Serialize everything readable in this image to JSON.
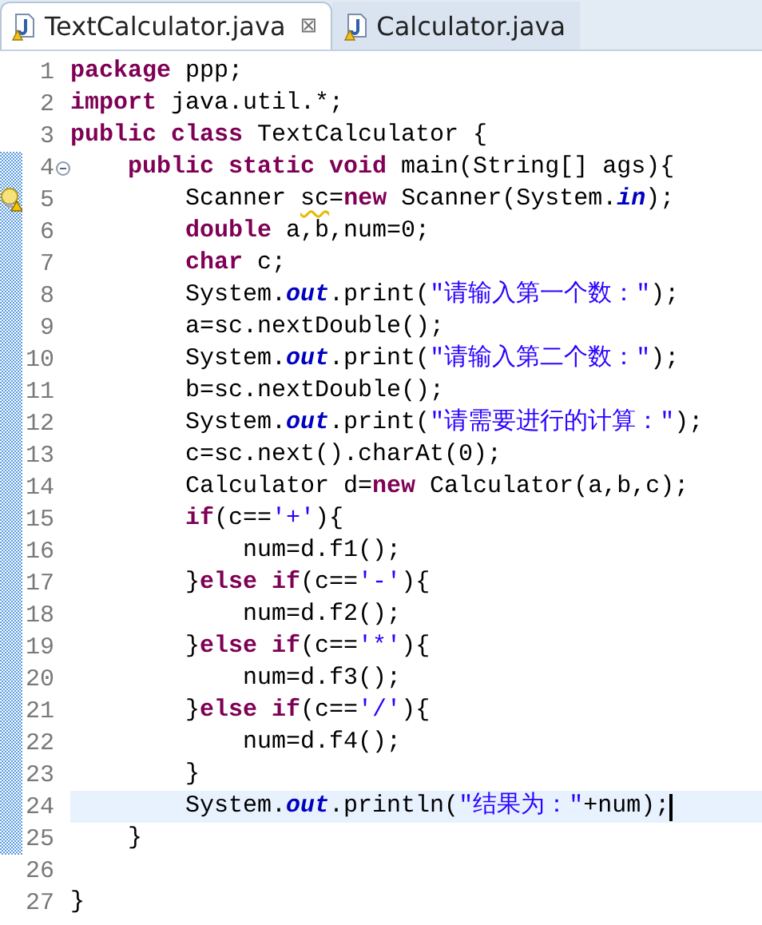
{
  "tabs": [
    {
      "label": "TextCalculator.java",
      "selected": true,
      "close": "⊠"
    },
    {
      "label": "Calculator.java",
      "selected": false
    }
  ],
  "lines": [
    {
      "number": "1",
      "changed": false,
      "current": false,
      "collapsible": false,
      "warning": false,
      "tokens": [
        {
          "kind": "kw",
          "text": "package"
        },
        {
          "kind": "text",
          "text": " ppp;"
        }
      ]
    },
    {
      "number": "2",
      "changed": false,
      "current": false,
      "collapsible": false,
      "warning": false,
      "tokens": [
        {
          "kind": "kw",
          "text": "import"
        },
        {
          "kind": "text",
          "text": " java.util.*;"
        }
      ]
    },
    {
      "number": "3",
      "changed": false,
      "current": false,
      "collapsible": false,
      "warning": false,
      "tokens": [
        {
          "kind": "kw",
          "text": "public class"
        },
        {
          "kind": "text",
          "text": " TextCalculator {"
        }
      ]
    },
    {
      "number": "4",
      "changed": true,
      "current": false,
      "collapsible": true,
      "warning": false,
      "tokens": [
        {
          "kind": "kw",
          "text": "    public static void"
        },
        {
          "kind": "text",
          "text": " main(String[] ags){"
        }
      ]
    },
    {
      "number": "5",
      "changed": true,
      "current": false,
      "collapsible": false,
      "warning": true,
      "tokens": [
        {
          "kind": "text",
          "text": "        Scanner "
        },
        {
          "kind": "warn",
          "text": "sc"
        },
        {
          "kind": "text",
          "text": "="
        },
        {
          "kind": "kw",
          "text": "new"
        },
        {
          "kind": "text",
          "text": " Scanner(System."
        },
        {
          "kind": "field",
          "text": "in"
        },
        {
          "kind": "text",
          "text": ");"
        }
      ]
    },
    {
      "number": "6",
      "changed": true,
      "current": false,
      "collapsible": false,
      "warning": false,
      "tokens": [
        {
          "kind": "kw",
          "text": "        double"
        },
        {
          "kind": "text",
          "text": " a,b,num=0;"
        }
      ]
    },
    {
      "number": "7",
      "changed": true,
      "current": false,
      "collapsible": false,
      "warning": false,
      "tokens": [
        {
          "kind": "kw",
          "text": "        char"
        },
        {
          "kind": "text",
          "text": " c;"
        }
      ]
    },
    {
      "number": "8",
      "changed": true,
      "current": false,
      "collapsible": false,
      "warning": false,
      "tokens": [
        {
          "kind": "text",
          "text": "        System."
        },
        {
          "kind": "field",
          "text": "out"
        },
        {
          "kind": "text",
          "text": ".print("
        },
        {
          "kind": "str",
          "text": "\"请输入第一个数：\""
        },
        {
          "kind": "text",
          "text": ");"
        }
      ]
    },
    {
      "number": "9",
      "changed": true,
      "current": false,
      "collapsible": false,
      "warning": false,
      "tokens": [
        {
          "kind": "text",
          "text": "        a=sc.nextDouble();"
        }
      ]
    },
    {
      "number": "10",
      "changed": true,
      "current": false,
      "collapsible": false,
      "warning": false,
      "tokens": [
        {
          "kind": "text",
          "text": "        System."
        },
        {
          "kind": "field",
          "text": "out"
        },
        {
          "kind": "text",
          "text": ".print("
        },
        {
          "kind": "str",
          "text": "\"请输入第二个数：\""
        },
        {
          "kind": "text",
          "text": ");"
        }
      ]
    },
    {
      "number": "11",
      "changed": true,
      "current": false,
      "collapsible": false,
      "warning": false,
      "tokens": [
        {
          "kind": "text",
          "text": "        b=sc.nextDouble();"
        }
      ]
    },
    {
      "number": "12",
      "changed": true,
      "current": false,
      "collapsible": false,
      "warning": false,
      "tokens": [
        {
          "kind": "text",
          "text": "        System."
        },
        {
          "kind": "field",
          "text": "out"
        },
        {
          "kind": "text",
          "text": ".print("
        },
        {
          "kind": "str",
          "text": "\"请需要进行的计算：\""
        },
        {
          "kind": "text",
          "text": ");"
        }
      ]
    },
    {
      "number": "13",
      "changed": true,
      "current": false,
      "collapsible": false,
      "warning": false,
      "tokens": [
        {
          "kind": "text",
          "text": "        c=sc.next().charAt(0);"
        }
      ]
    },
    {
      "number": "14",
      "changed": true,
      "current": false,
      "collapsible": false,
      "warning": false,
      "tokens": [
        {
          "kind": "text",
          "text": "        Calculator d="
        },
        {
          "kind": "kw",
          "text": "new"
        },
        {
          "kind": "text",
          "text": " Calculator(a,b,c);"
        }
      ]
    },
    {
      "number": "15",
      "changed": true,
      "current": false,
      "collapsible": false,
      "warning": false,
      "tokens": [
        {
          "kind": "kw",
          "text": "        if"
        },
        {
          "kind": "text",
          "text": "(c=="
        },
        {
          "kind": "str",
          "text": "'+'"
        },
        {
          "kind": "text",
          "text": "){"
        }
      ]
    },
    {
      "number": "16",
      "changed": true,
      "current": false,
      "collapsible": false,
      "warning": false,
      "tokens": [
        {
          "kind": "text",
          "text": "            num=d.f1();"
        }
      ]
    },
    {
      "number": "17",
      "changed": true,
      "current": false,
      "collapsible": false,
      "warning": false,
      "tokens": [
        {
          "kind": "text",
          "text": "        }"
        },
        {
          "kind": "kw",
          "text": "else if"
        },
        {
          "kind": "text",
          "text": "(c=="
        },
        {
          "kind": "str",
          "text": "'-'"
        },
        {
          "kind": "text",
          "text": "){"
        }
      ]
    },
    {
      "number": "18",
      "changed": true,
      "current": false,
      "collapsible": false,
      "warning": false,
      "tokens": [
        {
          "kind": "text",
          "text": "            num=d.f2();"
        }
      ]
    },
    {
      "number": "19",
      "changed": true,
      "current": false,
      "collapsible": false,
      "warning": false,
      "tokens": [
        {
          "kind": "text",
          "text": "        }"
        },
        {
          "kind": "kw",
          "text": "else if"
        },
        {
          "kind": "text",
          "text": "(c=="
        },
        {
          "kind": "str",
          "text": "'*'"
        },
        {
          "kind": "text",
          "text": "){"
        }
      ]
    },
    {
      "number": "20",
      "changed": true,
      "current": false,
      "collapsible": false,
      "warning": false,
      "tokens": [
        {
          "kind": "text",
          "text": "            num=d.f3();"
        }
      ]
    },
    {
      "number": "21",
      "changed": true,
      "current": false,
      "collapsible": false,
      "warning": false,
      "tokens": [
        {
          "kind": "text",
          "text": "        }"
        },
        {
          "kind": "kw",
          "text": "else if"
        },
        {
          "kind": "text",
          "text": "(c=="
        },
        {
          "kind": "str",
          "text": "'/'"
        },
        {
          "kind": "text",
          "text": "){"
        }
      ]
    },
    {
      "number": "22",
      "changed": true,
      "current": false,
      "collapsible": false,
      "warning": false,
      "tokens": [
        {
          "kind": "text",
          "text": "            num=d.f4();"
        }
      ]
    },
    {
      "number": "23",
      "changed": true,
      "current": false,
      "collapsible": false,
      "warning": false,
      "tokens": [
        {
          "kind": "text",
          "text": "        }"
        }
      ]
    },
    {
      "number": "24",
      "changed": true,
      "current": true,
      "collapsible": false,
      "warning": false,
      "tokens": [
        {
          "kind": "text",
          "text": "        System."
        },
        {
          "kind": "field",
          "text": "out"
        },
        {
          "kind": "text",
          "text": ".println("
        },
        {
          "kind": "str",
          "text": "\"结果为：\""
        },
        {
          "kind": "text",
          "text": "+num);"
        }
      ]
    },
    {
      "number": "25",
      "changed": true,
      "current": false,
      "collapsible": false,
      "warning": false,
      "tokens": [
        {
          "kind": "text",
          "text": "    }"
        }
      ]
    },
    {
      "number": "26",
      "changed": false,
      "current": false,
      "collapsible": false,
      "warning": false
    },
    {
      "number": "27",
      "changed": false,
      "current": false,
      "collapsible": false,
      "warning": false,
      "tokens": [
        {
          "kind": "text",
          "text": "}"
        }
      ]
    }
  ]
}
